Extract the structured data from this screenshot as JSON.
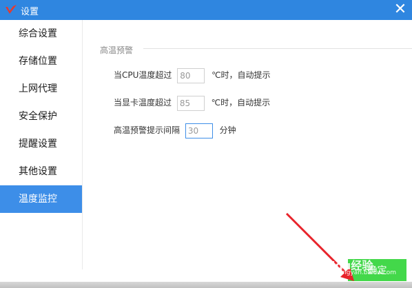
{
  "window": {
    "title": "设置",
    "close_icon": "close-icon"
  },
  "sidebar": {
    "items": [
      {
        "label": "综合设置"
      },
      {
        "label": "存储位置"
      },
      {
        "label": "上网代理"
      },
      {
        "label": "安全保护"
      },
      {
        "label": "提醒设置"
      },
      {
        "label": "其他设置"
      },
      {
        "label": "温度监控",
        "active": true
      }
    ]
  },
  "main": {
    "section_title": "高温预警",
    "cpu": {
      "label": "当CPU温度超过",
      "value": "80",
      "suffix": "℃时，自动提示"
    },
    "gpu": {
      "label": "当显卡温度超过",
      "value": "85",
      "suffix": "℃时，自动提示"
    },
    "interval": {
      "label": "高温预警提示间隔",
      "value": "30",
      "suffix": "分钟"
    }
  },
  "footer": {
    "ok_label": "确定"
  },
  "watermark": {
    "text": "Baidu经验",
    "sub": "jingyan.baidu.com"
  },
  "colors": {
    "titlebar": "#2f86e0",
    "active": "#3d8ee8",
    "ok": "#43d84a",
    "arrow": "#e8232b"
  }
}
